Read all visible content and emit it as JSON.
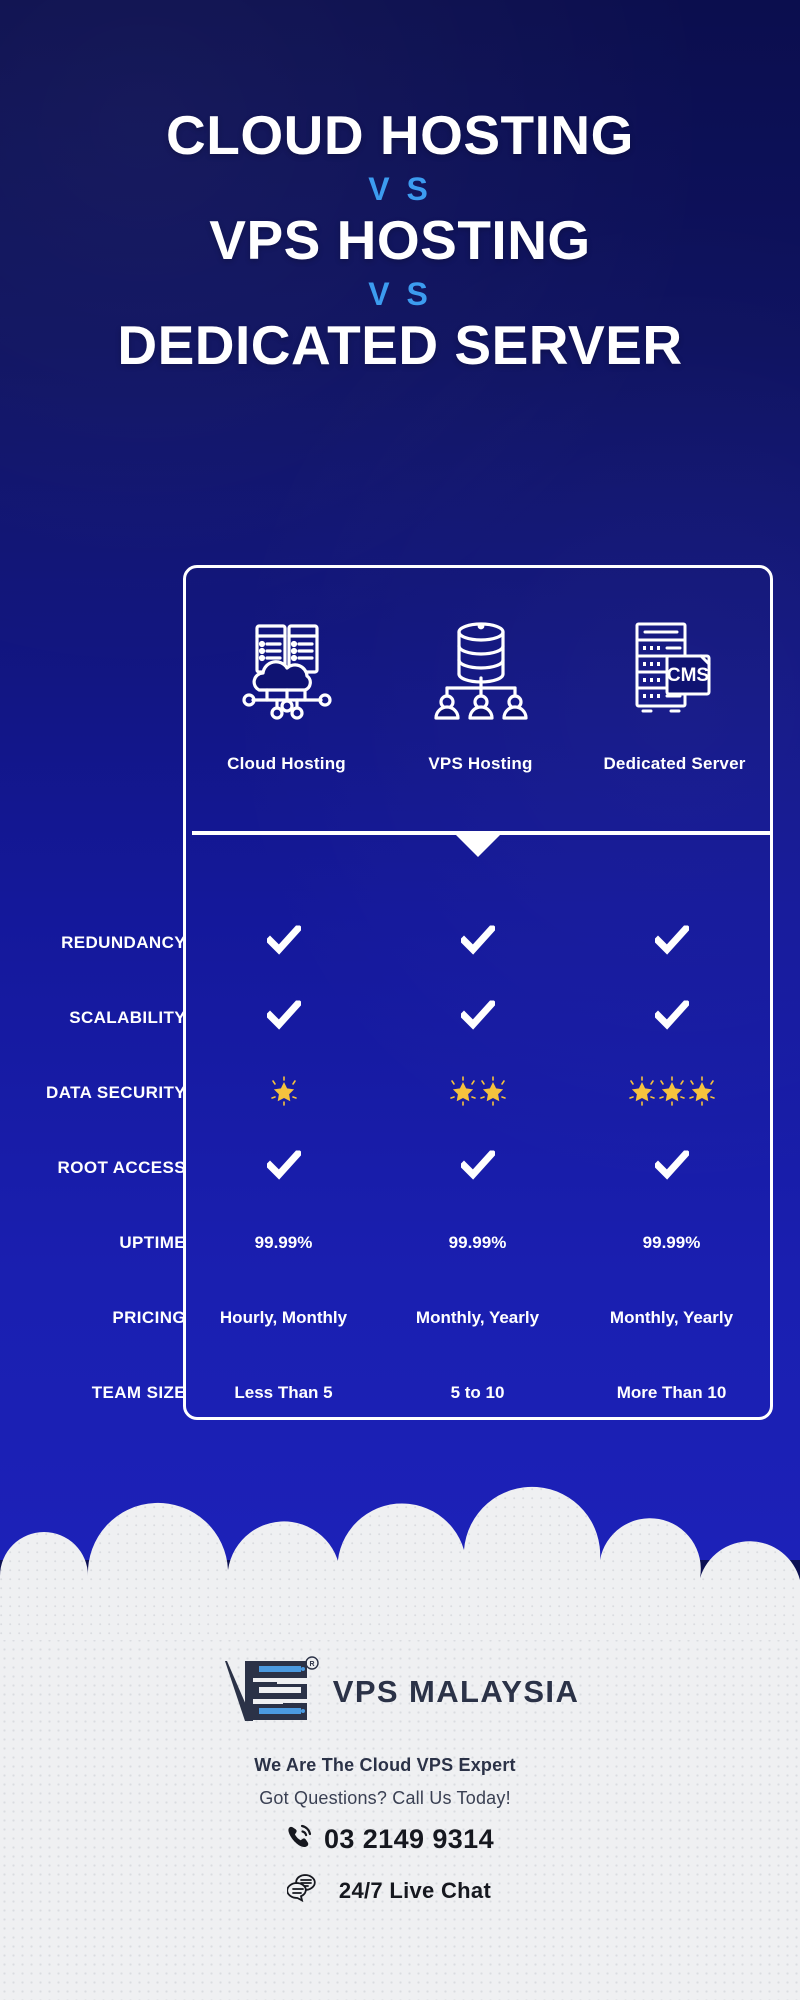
{
  "theme": {
    "bg_top": "#0b0e4e",
    "bg_bottom": "#1c21b8",
    "accent_blue": "#3c9cf0",
    "card_border": "#ffffff",
    "footer_bg": "#eff0f2",
    "logo_navy": "#2b3247",
    "star_gold": "#f5c23e"
  },
  "title": {
    "line1": "CLOUD HOSTING",
    "vs1": "V S",
    "line2": "VPS HOSTING",
    "vs2": "V S",
    "line3": "DEDICATED SERVER"
  },
  "columns": [
    {
      "label": "Cloud Hosting",
      "icon": "cloud-server-network-icon"
    },
    {
      "label": "VPS Hosting",
      "icon": "database-users-tree-icon"
    },
    {
      "label": "Dedicated Server",
      "icon": "server-rack-cms-icon"
    }
  ],
  "chart_data": {
    "type": "table",
    "title": "Cloud Hosting V S VPS Hosting V S Dedicated Server",
    "columns": [
      "",
      "Cloud Hosting",
      "VPS Hosting",
      "Dedicated Server"
    ],
    "rows": [
      {
        "label": "REDUNDANCY",
        "type": "check",
        "values": [
          "check",
          "check",
          "check"
        ]
      },
      {
        "label": "SCALABILITY",
        "type": "check",
        "values": [
          "check",
          "check",
          "check"
        ]
      },
      {
        "label": "DATA SECURITY",
        "type": "stars",
        "values": [
          1,
          2,
          3
        ]
      },
      {
        "label": "ROOT ACCESS",
        "type": "check",
        "values": [
          "check",
          "check",
          "check"
        ]
      },
      {
        "label": "UPTIME",
        "type": "text",
        "values": [
          "99.99%",
          "99.99%",
          "99.99%"
        ]
      },
      {
        "label": "PRICING",
        "type": "text",
        "values": [
          "Hourly, Monthly",
          "Monthly, Yearly",
          "Monthly, Yearly"
        ]
      },
      {
        "label": "TEAM SIZE",
        "type": "text",
        "values": [
          "Less Than 5",
          "5 to 10",
          "More Than 10"
        ]
      }
    ]
  },
  "footer": {
    "brand_name": "VPS MALAYSIA",
    "registered_mark": "®",
    "tagline": "We Are The Cloud VPS Expert",
    "subtagline": "Got Questions? Call Us Today!",
    "phone": "03 2149 9314",
    "chat": "24/7 Live Chat",
    "phone_icon": "phone-ringing-icon",
    "chat_icon": "chat-bubbles-icon",
    "logo_icon": "vps-malaysia-logo-icon"
  }
}
